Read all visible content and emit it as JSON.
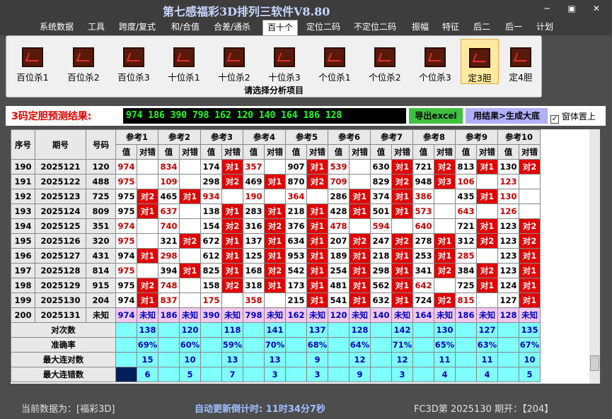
{
  "window": {
    "title": "第七感福彩3D排列三软件V8.80"
  },
  "menu": [
    "系统数据",
    "工具",
    "跨度/复式",
    "和/合值",
    "合差/通杀",
    "百十个",
    "定位二码",
    "不定位二码",
    "振幅",
    "特征",
    "后二",
    "后一",
    "计划"
  ],
  "ribbon": {
    "buttons": [
      "百位杀1",
      "百位杀2",
      "百位杀3",
      "十位杀1",
      "十位杀2",
      "十位杀3",
      "个位杀1",
      "个位杀2",
      "个位杀3",
      "定3胆",
      "定4胆"
    ],
    "footer": "请选择分析项目"
  },
  "result": {
    "label": "3码定胆预测结果:",
    "value": "974  186  390  798  162  120  140  164  186  128",
    "export_label": "导出excel",
    "generate_label": "用结果>生成大底",
    "ontop_label": "窗体置上"
  },
  "table": {
    "col_headers": [
      "序号",
      "期号",
      "号码"
    ],
    "ref_headers": [
      "参考1",
      "参考2",
      "参考3",
      "参考4",
      "参考5",
      "参考6",
      "参考7",
      "参考8",
      "参考9",
      "参考10"
    ],
    "sub_headers": [
      "值",
      "对错"
    ],
    "rows": [
      {
        "seq": "190",
        "period": "2025121",
        "num": "120",
        "cells": [
          [
            "974",
            ""
          ],
          [
            "834",
            ""
          ],
          [
            "174",
            "对1"
          ],
          [
            "357",
            ""
          ],
          [
            "907",
            "对1"
          ],
          [
            "539",
            ""
          ],
          [
            "630",
            "对1"
          ],
          [
            "721",
            "对2"
          ],
          [
            "813",
            "对1"
          ],
          [
            "130",
            "对2"
          ]
        ]
      },
      {
        "seq": "191",
        "period": "2025122",
        "num": "488",
        "cells": [
          [
            "975",
            ""
          ],
          [
            "109",
            ""
          ],
          [
            "298",
            "对2"
          ],
          [
            "469",
            "对1"
          ],
          [
            "870",
            "对2"
          ],
          [
            "709",
            ""
          ],
          [
            "829",
            "对2"
          ],
          [
            "948",
            "对3"
          ],
          [
            "106",
            ""
          ],
          [
            "123",
            ""
          ]
        ]
      },
      {
        "seq": "192",
        "period": "2025123",
        "num": "725",
        "cells": [
          [
            "975",
            "对2"
          ],
          [
            "465",
            "对1"
          ],
          [
            "934",
            ""
          ],
          [
            "190",
            ""
          ],
          [
            "364",
            ""
          ],
          [
            "286",
            "对1"
          ],
          [
            "374",
            "对1"
          ],
          [
            "386",
            ""
          ],
          [
            "435",
            "对1"
          ],
          [
            "130",
            ""
          ]
        ]
      },
      {
        "seq": "193",
        "period": "2025124",
        "num": "809",
        "cells": [
          [
            "975",
            "对1"
          ],
          [
            "637",
            ""
          ],
          [
            "138",
            "对1"
          ],
          [
            "283",
            "对1"
          ],
          [
            "218",
            "对1"
          ],
          [
            "428",
            "对1"
          ],
          [
            "501",
            "对1"
          ],
          [
            "573",
            ""
          ],
          [
            "643",
            ""
          ],
          [
            "126",
            ""
          ]
        ]
      },
      {
        "seq": "194",
        "period": "2025125",
        "num": "351",
        "cells": [
          [
            "974",
            ""
          ],
          [
            "740",
            ""
          ],
          [
            "154",
            "对2"
          ],
          [
            "316",
            "对2"
          ],
          [
            "376",
            "对1"
          ],
          [
            "478",
            ""
          ],
          [
            "594",
            ""
          ],
          [
            "640",
            ""
          ],
          [
            "721",
            "对1"
          ],
          [
            "123",
            "对2"
          ]
        ]
      },
      {
        "seq": "195",
        "period": "2025126",
        "num": "320",
        "cells": [
          [
            "975",
            ""
          ],
          [
            "321",
            "对2"
          ],
          [
            "672",
            "对1"
          ],
          [
            "137",
            "对1"
          ],
          [
            "634",
            "对1"
          ],
          [
            "207",
            "对2"
          ],
          [
            "247",
            "对2"
          ],
          [
            "278",
            "对1"
          ],
          [
            "312",
            "对2"
          ],
          [
            "123",
            "对2"
          ]
        ]
      },
      {
        "seq": "196",
        "period": "2025127",
        "num": "431",
        "cells": [
          [
            "974",
            "对1"
          ],
          [
            "298",
            ""
          ],
          [
            "612",
            "对1"
          ],
          [
            "125",
            "对1"
          ],
          [
            "953",
            "对1"
          ],
          [
            "189",
            "对1"
          ],
          [
            "218",
            "对1"
          ],
          [
            "253",
            "对1"
          ],
          [
            "285",
            ""
          ],
          [
            "123",
            "对1"
          ]
        ]
      },
      {
        "seq": "197",
        "period": "2025128",
        "num": "814",
        "cells": [
          [
            "975",
            ""
          ],
          [
            "394",
            "对1"
          ],
          [
            "825",
            "对1"
          ],
          [
            "168",
            "对2"
          ],
          [
            "542",
            "对1"
          ],
          [
            "254",
            "对1"
          ],
          [
            "298",
            "对1"
          ],
          [
            "341",
            "对2"
          ],
          [
            "384",
            "对2"
          ],
          [
            "123",
            "对1"
          ]
        ]
      },
      {
        "seq": "198",
        "period": "2025129",
        "num": "915",
        "cells": [
          [
            "975",
            "对2"
          ],
          [
            "748",
            ""
          ],
          [
            "158",
            "对2"
          ],
          [
            "318",
            "对1"
          ],
          [
            "173",
            "对1"
          ],
          [
            "481",
            "对1"
          ],
          [
            "562",
            "对1"
          ],
          [
            "642",
            ""
          ],
          [
            "725",
            "对1"
          ],
          [
            "124",
            "对1"
          ]
        ]
      },
      {
        "seq": "199",
        "period": "2025130",
        "num": "204",
        "cells": [
          [
            "974",
            "对1"
          ],
          [
            "837",
            ""
          ],
          [
            "175",
            ""
          ],
          [
            "358",
            ""
          ],
          [
            "215",
            "对1"
          ],
          [
            "541",
            "对1"
          ],
          [
            "632",
            "对1"
          ],
          [
            "724",
            "对2"
          ],
          [
            "815",
            ""
          ],
          [
            "127",
            "对1"
          ]
        ]
      }
    ],
    "pred_row": {
      "seq": "200",
      "period": "2025131",
      "num": "未知",
      "values": [
        "974",
        "186",
        "390",
        "798",
        "162",
        "120",
        "140",
        "164",
        "186",
        "128"
      ],
      "status": "未知"
    },
    "stats": [
      {
        "label": "对次数",
        "values": [
          "138",
          "120",
          "118",
          "141",
          "137",
          "128",
          "142",
          "130",
          "127",
          "135"
        ]
      },
      {
        "label": "准确率",
        "values": [
          "69%",
          "60%",
          "59%",
          "70%",
          "68%",
          "64%",
          "71%",
          "65%",
          "63%",
          "67%"
        ]
      },
      {
        "label": "最大连对数",
        "values": [
          "15",
          "10",
          "13",
          "13",
          "9",
          "12",
          "12",
          "11",
          "11",
          "10"
        ]
      },
      {
        "label": "最大连错数",
        "values": [
          "6",
          "5",
          "7",
          "3",
          "3",
          "9",
          "3",
          "4",
          "4",
          "5"
        ]
      }
    ]
  },
  "status": {
    "left": "当前数据为：[福彩3D]",
    "mid": "自动更新倒计时:  11时34分7秒",
    "right": "FC3D第 2025130 期开：【204】"
  }
}
